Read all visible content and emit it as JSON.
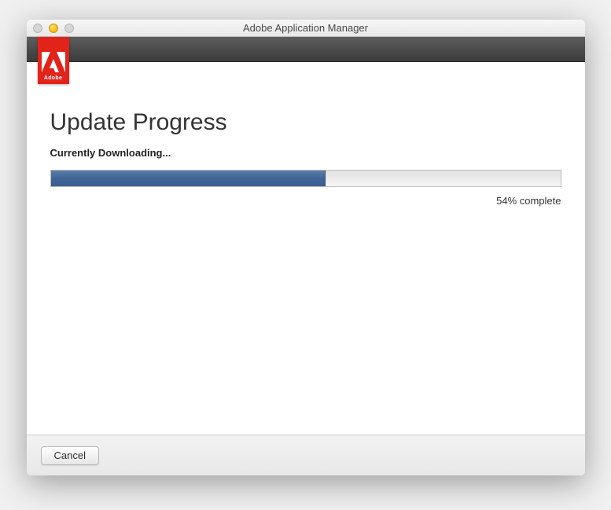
{
  "window": {
    "title": "Adobe Application Manager"
  },
  "logo": {
    "brand": "Adobe"
  },
  "main": {
    "heading": "Update Progress",
    "status": "Currently Downloading...",
    "progress_percent": 54,
    "progress_label": "54% complete"
  },
  "footer": {
    "cancel_label": "Cancel"
  }
}
